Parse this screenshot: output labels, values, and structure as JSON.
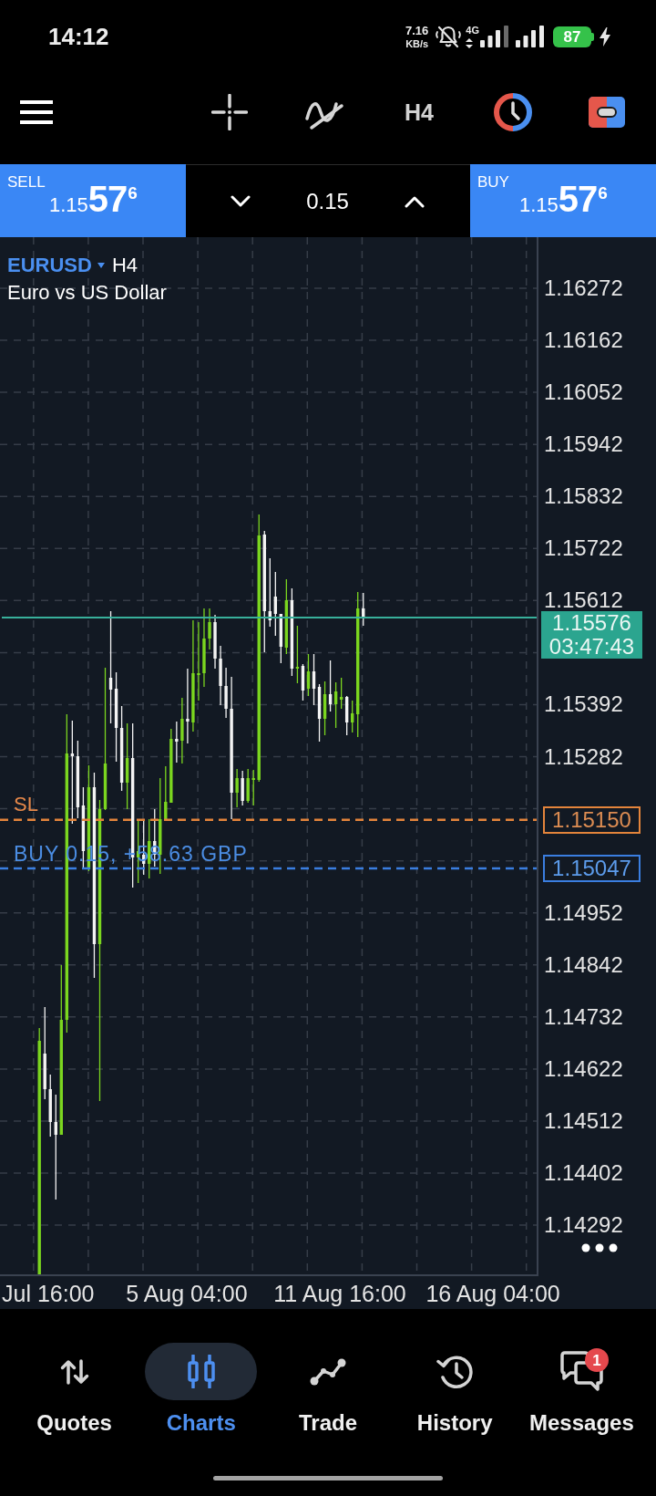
{
  "status_bar": {
    "time": "14:12",
    "net_speed": "7.16",
    "net_speed_unit": "KB/s",
    "network_type": "4G",
    "battery": "87"
  },
  "toolbar": {
    "timeframe": "H4"
  },
  "trade_panel": {
    "sell": {
      "label": "SELL",
      "price": "1.15576"
    },
    "volume": "0.15",
    "buy": {
      "label": "BUY",
      "price": "1.15576"
    }
  },
  "chart": {
    "symbol": "EURUSD",
    "timeframe": "H4",
    "description": "Euro vs US Dollar",
    "price_axis": {
      "upper": [
        "1.16272",
        "1.16162",
        "1.16052",
        "1.15942",
        "1.15832",
        "1.15722",
        "1.15612"
      ],
      "middle": [
        "1.15392",
        "1.15282"
      ],
      "lower": [
        "1.14952",
        "1.14842",
        "1.14732",
        "1.14622",
        "1.14512",
        "1.14402",
        "1.14292"
      ]
    },
    "current_price": {
      "price": "1.15576",
      "countdown": "03:47:43"
    },
    "stop_loss": {
      "label": "SL",
      "price": "1.15150"
    },
    "position": {
      "label": "BUY 0.15, +58.63 GBP",
      "price": "1.15047"
    },
    "time_axis": [
      "Jul 16:00",
      "5 Aug 04:00",
      "11 Aug 16:00",
      "16 Aug 04:00"
    ]
  },
  "bottom_nav": [
    {
      "label": "Quotes",
      "selected": false
    },
    {
      "label": "Charts",
      "selected": true
    },
    {
      "label": "Trade",
      "selected": false
    },
    {
      "label": "History",
      "selected": false
    },
    {
      "label": "Messages",
      "selected": false,
      "badge": "1"
    }
  ]
}
